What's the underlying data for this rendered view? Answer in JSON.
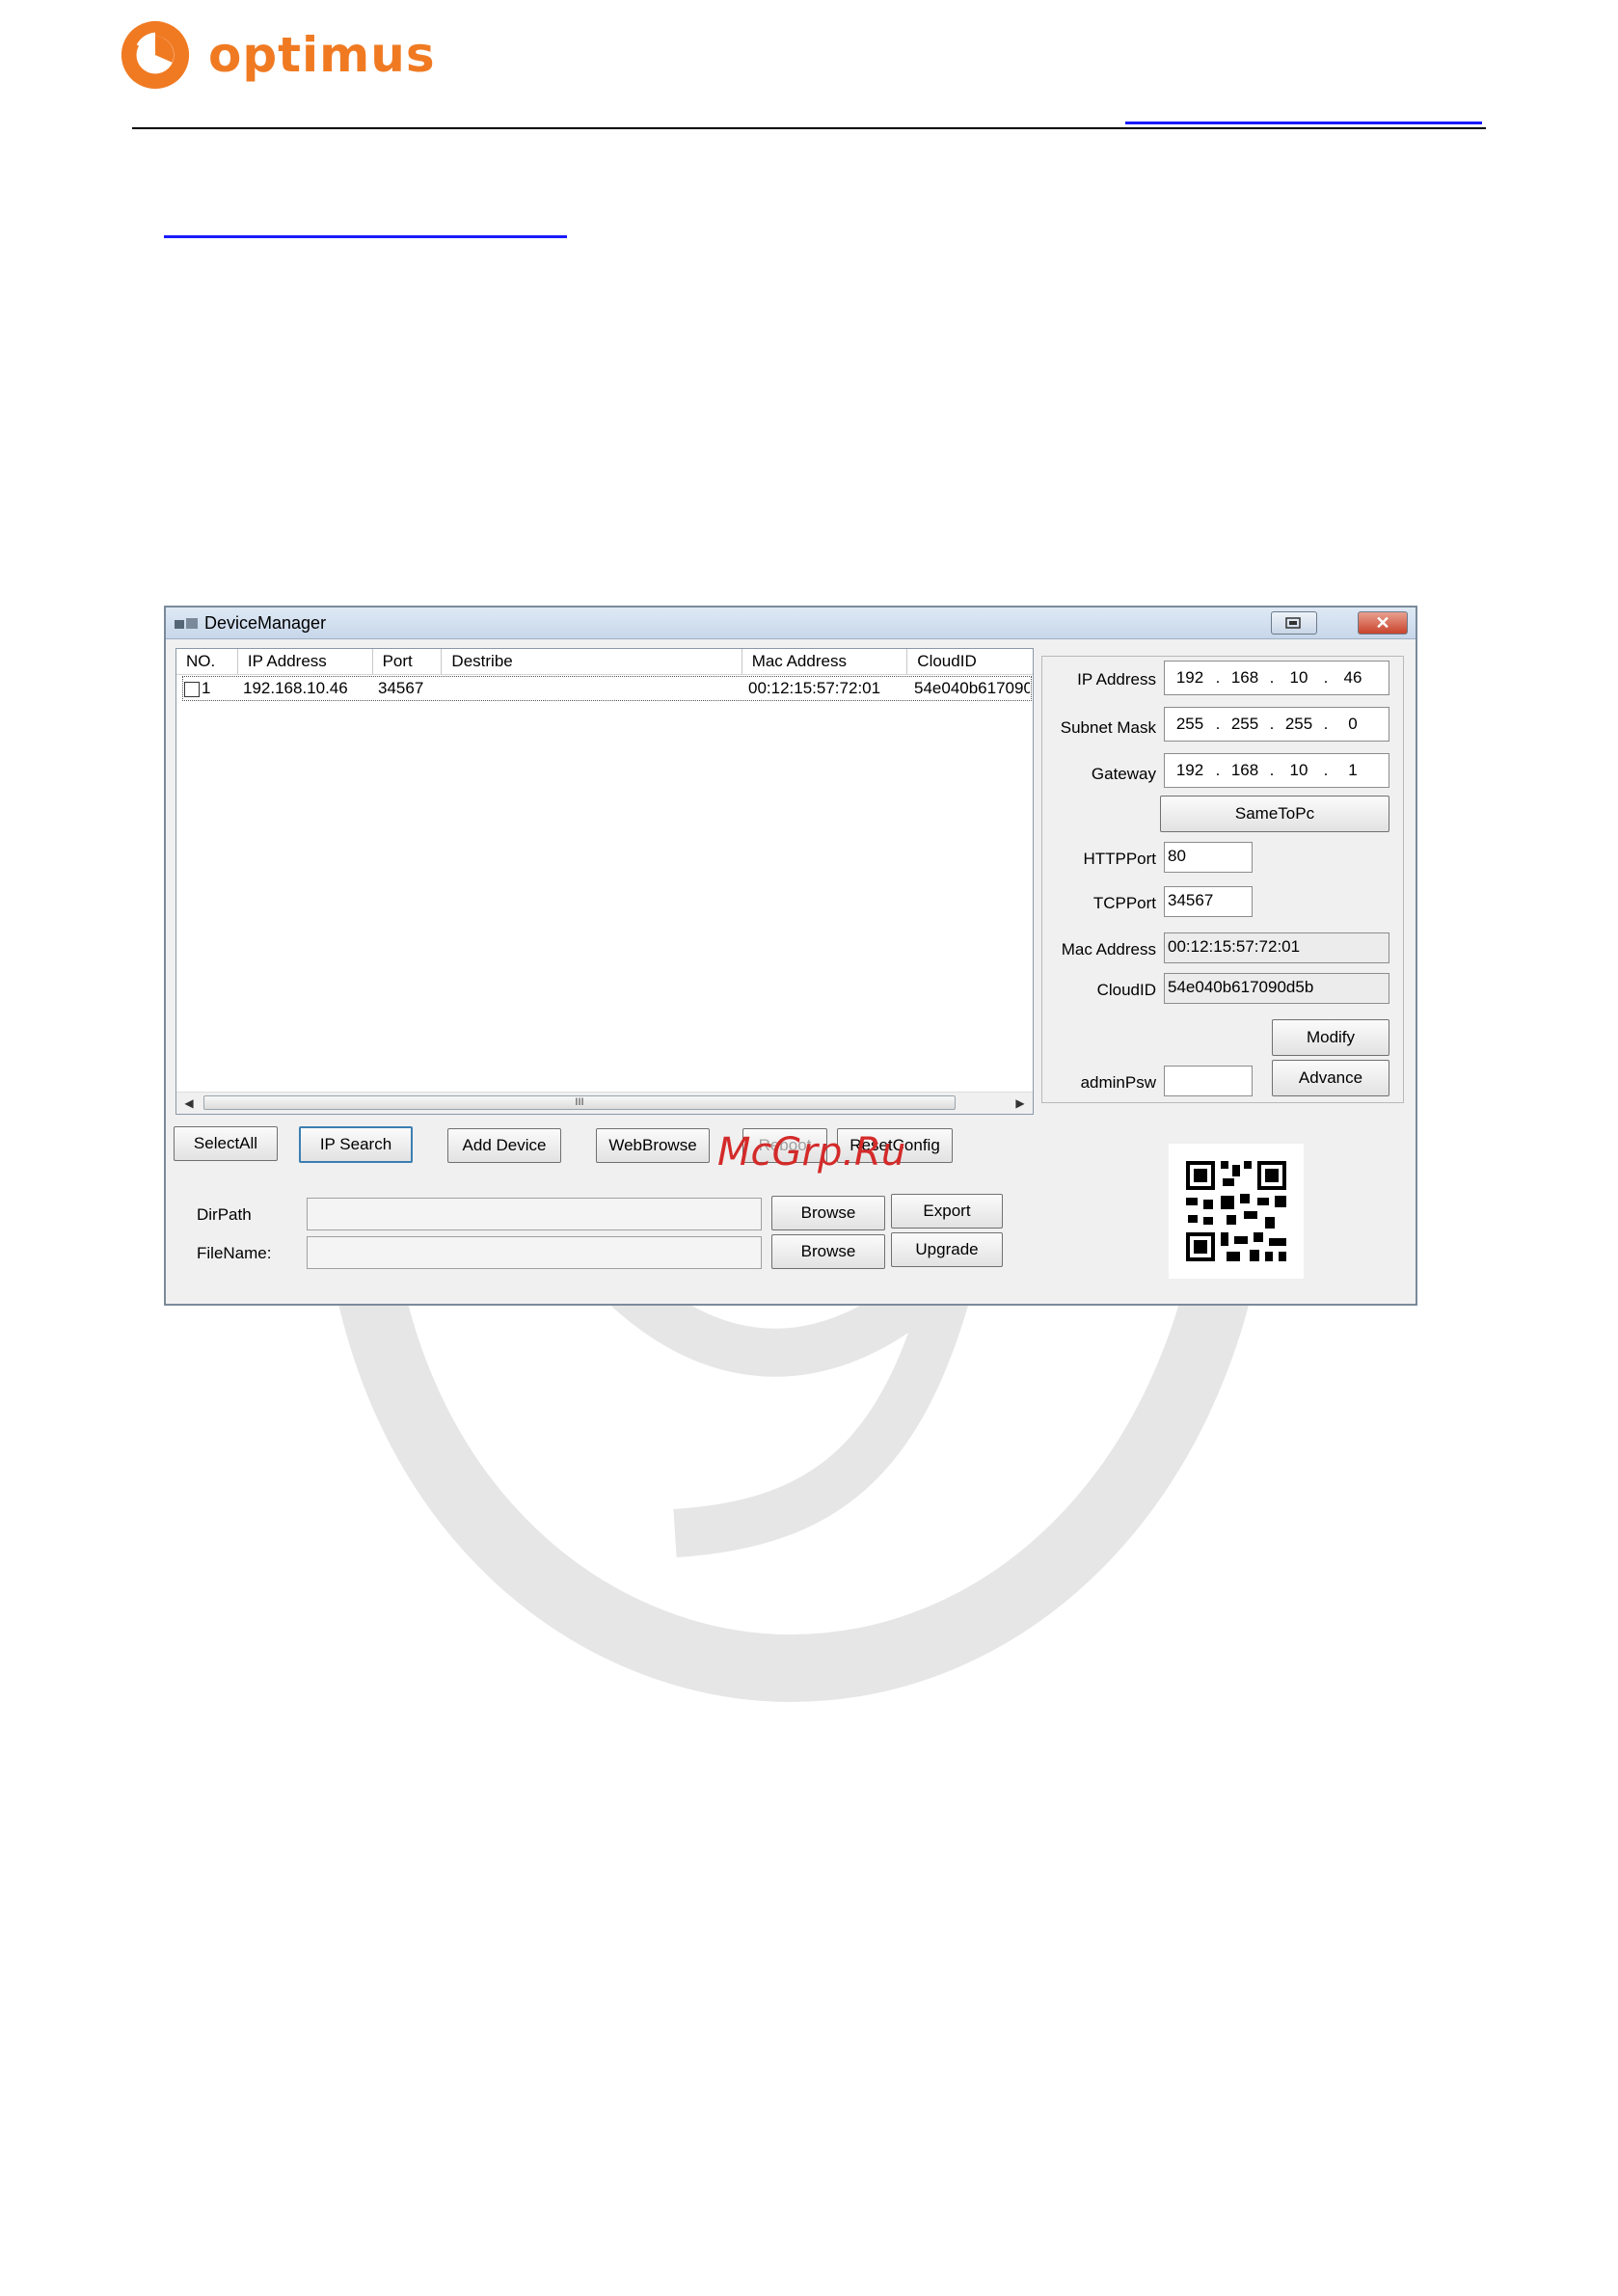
{
  "brand": {
    "name": "optimus",
    "color": "#f07a22"
  },
  "window": {
    "title": "DeviceManager",
    "close_glyph": "✕",
    "columns": [
      "NO.",
      "IP Address",
      "Port",
      "Destribe",
      "Mac Address",
      "CloudID"
    ],
    "rows": [
      {
        "no": "1",
        "ip": "192.168.10.46",
        "port": "34567",
        "describe": "",
        "mac": "00:12:15:57:72:01",
        "cloud": "54e040b617090"
      }
    ],
    "scroll_grip": "III"
  },
  "network": {
    "ip_label": "IP Address",
    "ip": [
      "192",
      "168",
      "10",
      "46"
    ],
    "mask_label": "Subnet Mask",
    "mask": [
      "255",
      "255",
      "255",
      "0"
    ],
    "gateway_label": "Gateway",
    "gateway": [
      "192",
      "168",
      "10",
      "1"
    ],
    "same_to_pc": "SameToPc",
    "http_label": "HTTPPort",
    "http_port": "80",
    "tcp_label": "TCPPort",
    "tcp_port": "34567",
    "mac_label": "Mac Address",
    "mac": "00:12:15:57:72:01",
    "cloud_label": "CloudID",
    "cloud": "54e040b617090d5b",
    "modify": "Modify",
    "admin_label": "adminPsw",
    "advance": "Advance"
  },
  "actions": {
    "select_all": "SelectAll",
    "ip_search": "IP Search",
    "add_device": "Add Device",
    "web_browse": "WebBrowse",
    "reboot": "Reboot",
    "reset_config": "ResetConfig"
  },
  "files": {
    "dir_label": "DirPath",
    "file_label": "FileName:",
    "browse": "Browse",
    "export": "Export",
    "upgrade": "Upgrade"
  },
  "overlay": {
    "watermark_text": "McGrp.Ru"
  }
}
